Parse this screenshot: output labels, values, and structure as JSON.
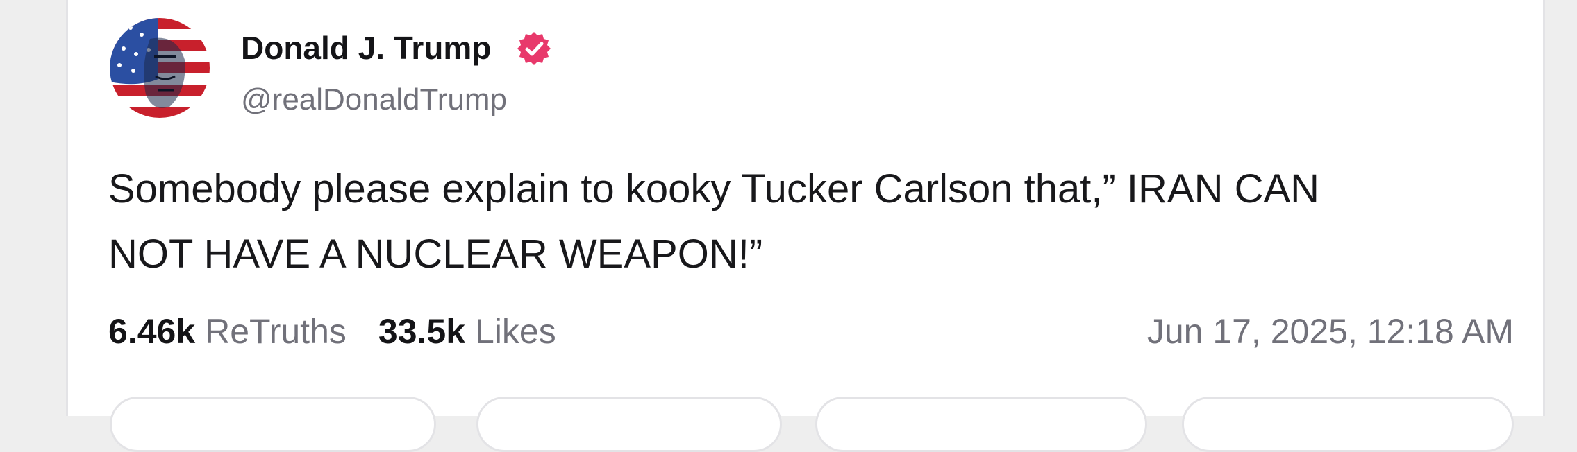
{
  "post": {
    "author": {
      "display_name": "Donald J. Trump",
      "handle": "@realDonaldTrump",
      "verified": true,
      "avatar_icon": "flag-portrait-avatar"
    },
    "text": "Somebody please explain to kooky Tucker Carlson that,” IRAN CAN\nNOT HAVE A NUCLEAR WEAPON!”",
    "stats": {
      "retruths_count": "6.46k",
      "retruths_label": "ReTruths",
      "likes_count": "33.5k",
      "likes_label": "Likes"
    },
    "timestamp": "Jun 17, 2025, 12:18 AM"
  },
  "colors": {
    "verified_badge": "#e8396b",
    "text_primary": "#18181b",
    "text_secondary": "#71717a",
    "border": "#e3e3e6"
  },
  "action_buttons": [
    "reply-button",
    "retruth-button",
    "like-button",
    "share-button"
  ]
}
